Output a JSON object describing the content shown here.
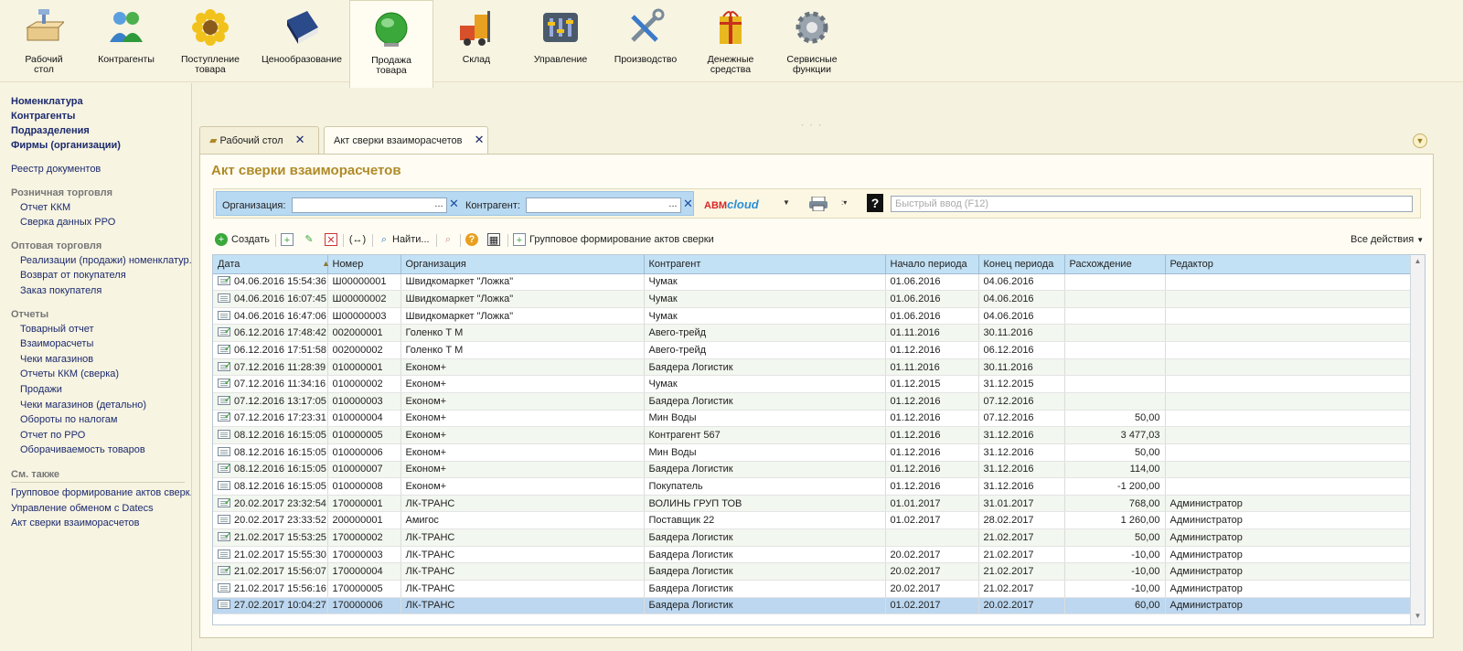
{
  "sections": [
    {
      "label": "Рабочий\nстол",
      "icon": "desktop-icon"
    },
    {
      "label": "Контрагенты",
      "icon": "people-icon"
    },
    {
      "label": "Поступление\nтовара",
      "icon": "sunflower-icon"
    },
    {
      "label": "Ценообразование",
      "icon": "book-icon"
    },
    {
      "label": "Продажа\nтовара",
      "icon": "globe-icon"
    },
    {
      "label": "Склад",
      "icon": "forklift-icon"
    },
    {
      "label": "Управление",
      "icon": "equalizer-icon"
    },
    {
      "label": "Производство",
      "icon": "tools-icon"
    },
    {
      "label": "Денежные\nсредства",
      "icon": "money-icon"
    },
    {
      "label": "Сервисные\nфункции",
      "icon": "gear-icon"
    }
  ],
  "left_panel": {
    "top_bold": [
      "Номенклатура",
      "Контрагенты",
      "Подразделения",
      "Фирмы (организации)"
    ],
    "registry": "Реестр документов",
    "retail_header": "Розничная торговля",
    "retail_items": [
      "Отчет ККМ",
      "Сверка данных РРО"
    ],
    "wholesale_header": "Оптовая торговля",
    "wholesale_items": [
      "Реализации (продажи) номенклатур...",
      "Возврат от покупателя",
      "Заказ покупателя"
    ],
    "reports_header": "Отчеты",
    "reports_items": [
      "Товарный отчет",
      "Взаиморасчеты",
      "Чеки магазинов",
      "Отчеты ККМ (сверка)",
      "Продажи",
      "Чеки магазинов (детально)",
      "Обороты по налогам",
      "Отчет по РРО",
      "Оборачиваемость товаров"
    ],
    "see_also_header": "См. также",
    "see_also_items": [
      "Групповое формирование актов сверк...",
      "Управление обменом с Datecs",
      "Акт сверки взаиморасчетов"
    ]
  },
  "tabs": [
    {
      "label": "Рабочий стол"
    },
    {
      "label": "Акт сверки взаиморасчетов"
    }
  ],
  "form": {
    "title": "Акт сверки взаиморасчетов",
    "org_label": "Организация:",
    "org_value": "",
    "contr_label": "Контрагент:",
    "contr_value": "",
    "dots": "...",
    "abm_a": "ABM",
    "abm_c": "cloud",
    "quick_placeholder": "Быстрый ввод (F12)"
  },
  "toolbar": {
    "create": "Создать",
    "find": "Найти...",
    "group": "Групповое формирование актов сверки",
    "all_actions": "Все действия"
  },
  "table": {
    "columns": [
      "Дата",
      "Номер",
      "Организация",
      "Контрагент",
      "Начало периода",
      "Конец периода",
      "Расхождение",
      "Редактор"
    ],
    "rows": [
      {
        "posted": true,
        "date": "04.06.2016 15:54:36",
        "num": "Ш00000001",
        "org": "Швидкомаркет \"Ложка\"",
        "contr": "Чумак",
        "start": "01.06.2016",
        "end": "04.06.2016",
        "diff": "",
        "editor": ""
      },
      {
        "posted": false,
        "date": "04.06.2016 16:07:45",
        "num": "Ш00000002",
        "org": "Швидкомаркет \"Ложка\"",
        "contr": "Чумак",
        "start": "01.06.2016",
        "end": "04.06.2016",
        "diff": "",
        "editor": ""
      },
      {
        "posted": false,
        "date": "04.06.2016 16:47:06",
        "num": "Ш00000003",
        "org": "Швидкомаркет \"Ложка\"",
        "contr": "Чумак",
        "start": "01.06.2016",
        "end": "04.06.2016",
        "diff": "",
        "editor": ""
      },
      {
        "posted": true,
        "date": "06.12.2016 17:48:42",
        "num": "002000001",
        "org": "Голенко Т М",
        "contr": "Авего-трейд",
        "start": "01.11.2016",
        "end": "30.11.2016",
        "diff": "",
        "editor": ""
      },
      {
        "posted": true,
        "date": "06.12.2016 17:51:58",
        "num": "002000002",
        "org": "Голенко Т М",
        "contr": "Авего-трейд",
        "start": "01.12.2016",
        "end": "06.12.2016",
        "diff": "",
        "editor": ""
      },
      {
        "posted": true,
        "date": "07.12.2016 11:28:39",
        "num": "010000001",
        "org": "Економ+",
        "contr": "Баядера Логистик",
        "start": "01.11.2016",
        "end": "30.11.2016",
        "diff": "",
        "editor": ""
      },
      {
        "posted": true,
        "date": "07.12.2016 11:34:16",
        "num": "010000002",
        "org": "Економ+",
        "contr": "Чумак",
        "start": "01.12.2015",
        "end": "31.12.2015",
        "diff": "",
        "editor": ""
      },
      {
        "posted": true,
        "date": "07.12.2016 13:17:05",
        "num": "010000003",
        "org": "Економ+",
        "contr": "Баядера Логистик",
        "start": "01.12.2016",
        "end": "07.12.2016",
        "diff": "",
        "editor": ""
      },
      {
        "posted": true,
        "date": "07.12.2016 17:23:31",
        "num": "010000004",
        "org": "Економ+",
        "contr": "Мин Воды",
        "start": "01.12.2016",
        "end": "07.12.2016",
        "diff": "50,00",
        "editor": ""
      },
      {
        "posted": false,
        "date": "08.12.2016 16:15:05",
        "num": "010000005",
        "org": "Економ+",
        "contr": "Контрагент 567",
        "start": "01.12.2016",
        "end": "31.12.2016",
        "diff": "3 477,03",
        "editor": ""
      },
      {
        "posted": false,
        "date": "08.12.2016 16:15:05",
        "num": "010000006",
        "org": "Економ+",
        "contr": "Мин Воды",
        "start": "01.12.2016",
        "end": "31.12.2016",
        "diff": "50,00",
        "editor": ""
      },
      {
        "posted": true,
        "date": "08.12.2016 16:15:05",
        "num": "010000007",
        "org": "Економ+",
        "contr": "Баядера Логистик",
        "start": "01.12.2016",
        "end": "31.12.2016",
        "diff": "114,00",
        "editor": ""
      },
      {
        "posted": false,
        "date": "08.12.2016 16:15:05",
        "num": "010000008",
        "org": "Економ+",
        "contr": "Покупатель",
        "start": "01.12.2016",
        "end": "31.12.2016",
        "diff": "-1 200,00",
        "editor": ""
      },
      {
        "posted": true,
        "date": "20.02.2017 23:32:54",
        "num": "170000001",
        "org": "ЛК-ТРАНС",
        "contr": "ВОЛИНЬ ГРУП ТОВ",
        "start": "01.01.2017",
        "end": "31.01.2017",
        "diff": "768,00",
        "editor": "Администратор"
      },
      {
        "posted": false,
        "date": "20.02.2017 23:33:52",
        "num": "200000001",
        "org": "Амигос",
        "contr": "Поставщик 22",
        "start": "01.02.2017",
        "end": "28.02.2017",
        "diff": "1 260,00",
        "editor": "Администратор"
      },
      {
        "posted": true,
        "date": "21.02.2017 15:53:25",
        "num": "170000002",
        "org": "ЛК-ТРАНС",
        "contr": "Баядера Логистик",
        "start": "",
        "end": "21.02.2017",
        "diff": "50,00",
        "editor": "Администратор"
      },
      {
        "posted": false,
        "date": "21.02.2017 15:55:30",
        "num": "170000003",
        "org": "ЛК-ТРАНС",
        "contr": "Баядера Логистик",
        "start": "20.02.2017",
        "end": "21.02.2017",
        "diff": "-10,00",
        "editor": "Администратор"
      },
      {
        "posted": true,
        "date": "21.02.2017 15:56:07",
        "num": "170000004",
        "org": "ЛК-ТРАНС",
        "contr": "Баядера Логистик",
        "start": "20.02.2017",
        "end": "21.02.2017",
        "diff": "-10,00",
        "editor": "Администратор"
      },
      {
        "posted": false,
        "date": "21.02.2017 15:56:16",
        "num": "170000005",
        "org": "ЛК-ТРАНС",
        "contr": "Баядера Логистик",
        "start": "20.02.2017",
        "end": "21.02.2017",
        "diff": "-10,00",
        "editor": "Администратор"
      },
      {
        "posted": false,
        "date": "27.02.2017 10:04:27",
        "num": "170000006",
        "org": "ЛК-ТРАНС",
        "contr": "Баядера Логистик",
        "start": "01.02.2017",
        "end": "20.02.2017",
        "diff": "60,00",
        "editor": "Администратор",
        "selected": true
      }
    ]
  },
  "colors": {
    "accent_title": "#b08a28",
    "header_blue": "#c3e1f5",
    "selected_row": "#bcd7ef",
    "link": "#1c2a6e"
  }
}
